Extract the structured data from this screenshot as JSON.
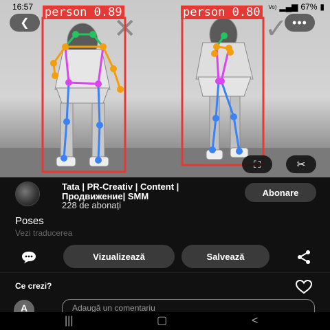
{
  "status_bar": {
    "time": "16:57",
    "battery": "67%",
    "net_label": "Vo)"
  },
  "photo": {
    "back_icon": "chevron-left-icon",
    "more_icon": "more-horizontal-icon",
    "lens_icon": "visual-search-icon",
    "scissors_icon": "scissors-icon",
    "detections": [
      {
        "label": "person 0.89"
      },
      {
        "label": "person 0.80"
      }
    ],
    "colors": {
      "box": "#e53935",
      "head": "#22c55e",
      "arms": "#f59e0b",
      "torso": "#d946ef",
      "legs": "#3b82f6"
    }
  },
  "creator": {
    "name": "Tata | PR-Creativ | Content | Продвижение| SMM",
    "followers": "228 de abonați",
    "follow_label": "Abonare"
  },
  "pin": {
    "title": "Poses",
    "translate_label": "Vezi traducerea"
  },
  "actions": {
    "comment_icon": "speech-bubble-icon",
    "view_label": "Vizualizează",
    "save_label": "Salvează",
    "share_icon": "share-icon"
  },
  "comments": {
    "label": "Ce crezi?",
    "like_icon": "heart-icon",
    "avatar_letter": "A",
    "placeholder": "Adaugă un comentariu"
  },
  "nav": {
    "recents_icon": "recents-icon",
    "home_icon": "home-icon",
    "back_icon": "back-icon"
  }
}
